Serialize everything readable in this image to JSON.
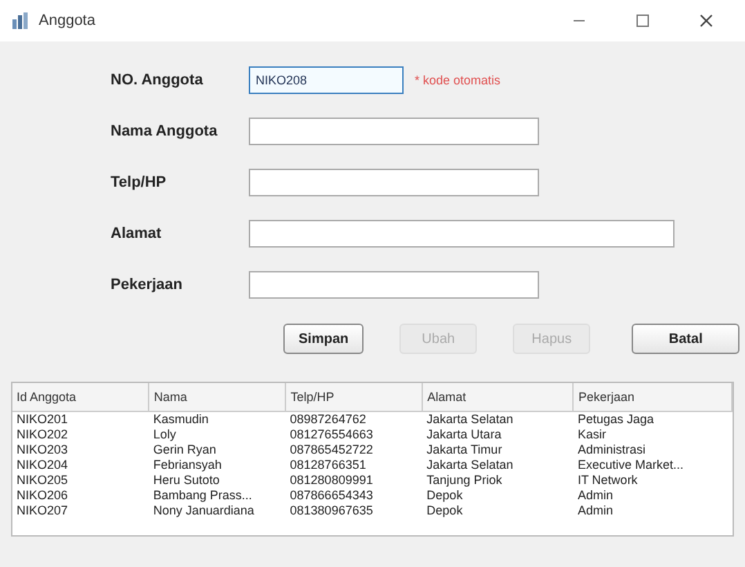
{
  "window": {
    "title": "Anggota"
  },
  "form": {
    "fields": [
      {
        "label": "NO. Anggota",
        "value": "NIKO208",
        "focused": true,
        "note": "* kode otomatis"
      },
      {
        "label": "Nama Anggota",
        "focused": false
      },
      {
        "label": "Telp/HP",
        "focused": false
      },
      {
        "label": "Alamat",
        "focused": false
      },
      {
        "label": "Pekerjaan",
        "focused": false
      }
    ]
  },
  "buttons": [
    {
      "label": "Simpan",
      "disabled": false
    },
    {
      "label": "Ubah",
      "disabled": true
    },
    {
      "label": "Hapus",
      "disabled": true
    },
    {
      "label": "Batal",
      "disabled": false
    }
  ],
  "table": {
    "columns": [
      "Id Anggota",
      "Nama",
      "Telp/HP",
      "Alamat",
      "Pekerjaan"
    ],
    "rows": [
      [
        "NIKO201",
        "Kasmudin",
        "08987264762",
        "Jakarta Selatan",
        "Petugas Jaga"
      ],
      [
        "NIKO202",
        "Loly",
        "081276554663",
        "Jakarta Utara",
        "Kasir"
      ],
      [
        "NIKO203",
        "Gerin Ryan",
        "087865452722",
        "Jakarta Timur",
        "Administrasi"
      ],
      [
        "NIKO204",
        "Febriansyah",
        "08128766351",
        "Jakarta Selatan",
        "Executive Market..."
      ],
      [
        "NIKO205",
        "Heru Sutoto",
        "081280809991",
        "Tanjung Priok",
        "IT Network"
      ],
      [
        "NIKO206",
        "Bambang Prass...",
        "087866654343",
        "Depok",
        "Admin"
      ],
      [
        "NIKO207",
        "Nony Januardiana",
        "081380967635",
        "Depok",
        "Admin"
      ]
    ]
  }
}
